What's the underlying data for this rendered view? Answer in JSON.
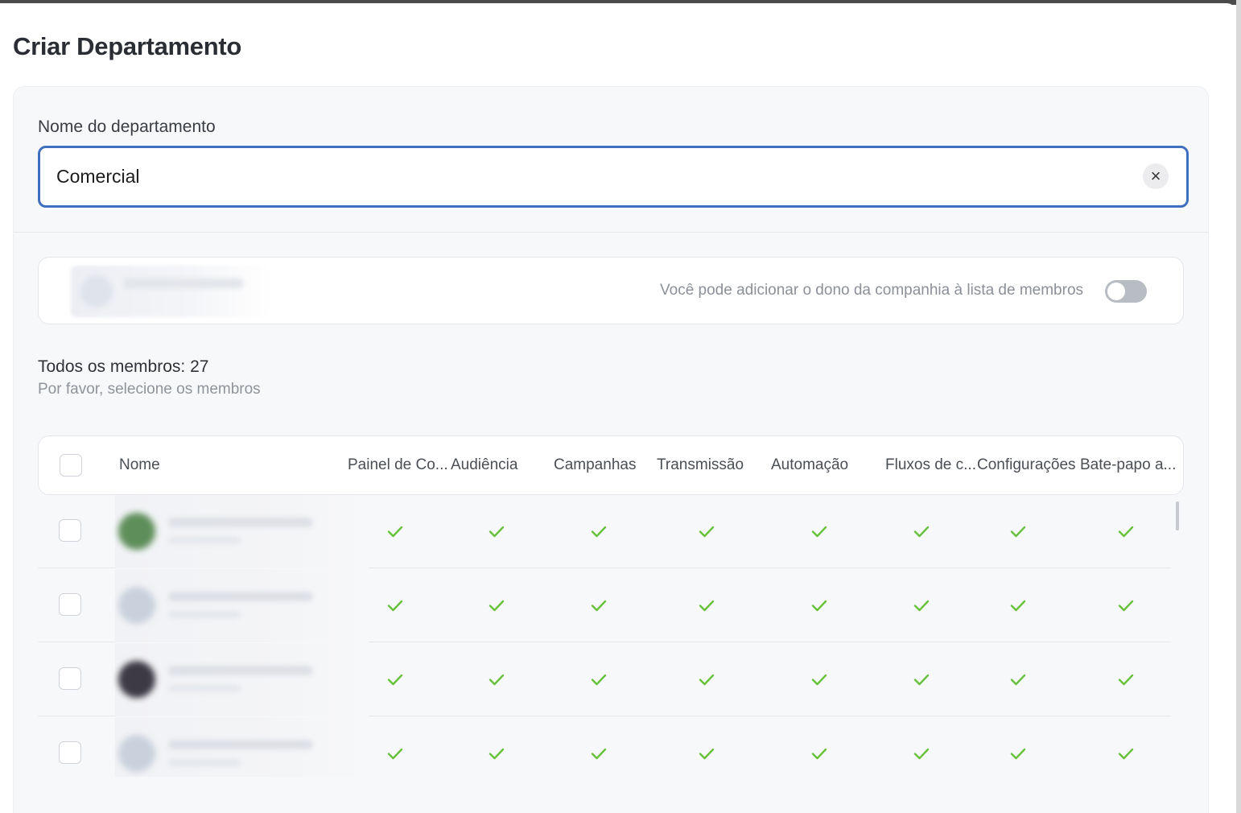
{
  "dialog": {
    "title": "Criar Departamento"
  },
  "department_name": {
    "label": "Nome do departamento",
    "value": "Comercial",
    "clear_label": "×"
  },
  "owner": {
    "text": "Você pode adicionar o dono da companhia à lista de membros",
    "toggle_on": false
  },
  "members": {
    "count_label": "Todos os membros: 27",
    "hint": "Por favor, selecione os membros"
  },
  "table": {
    "columns": [
      "Nome",
      "Painel de Co...",
      "Audiência",
      "Campanhas",
      "Transmissão",
      "Automação",
      "Fluxos de c...",
      "Configurações",
      "Bate-papo a..."
    ],
    "rows": [
      {
        "avatar_color": "#5e8f5a",
        "permissions": [
          true,
          true,
          true,
          true,
          true,
          true,
          true,
          true
        ]
      },
      {
        "avatar_color": "#c9d1dd",
        "permissions": [
          true,
          true,
          true,
          true,
          true,
          true,
          true,
          true
        ]
      },
      {
        "avatar_color": "#3d3a44",
        "permissions": [
          true,
          true,
          true,
          true,
          true,
          true,
          true,
          true
        ]
      },
      {
        "avatar_color": "#c9d1dd",
        "permissions": [
          true,
          true,
          true,
          true,
          true,
          true,
          true,
          true
        ]
      }
    ]
  },
  "colors": {
    "accent": "#3f6fc0",
    "check": "#67c23a",
    "panel": "#f7f8fa"
  }
}
